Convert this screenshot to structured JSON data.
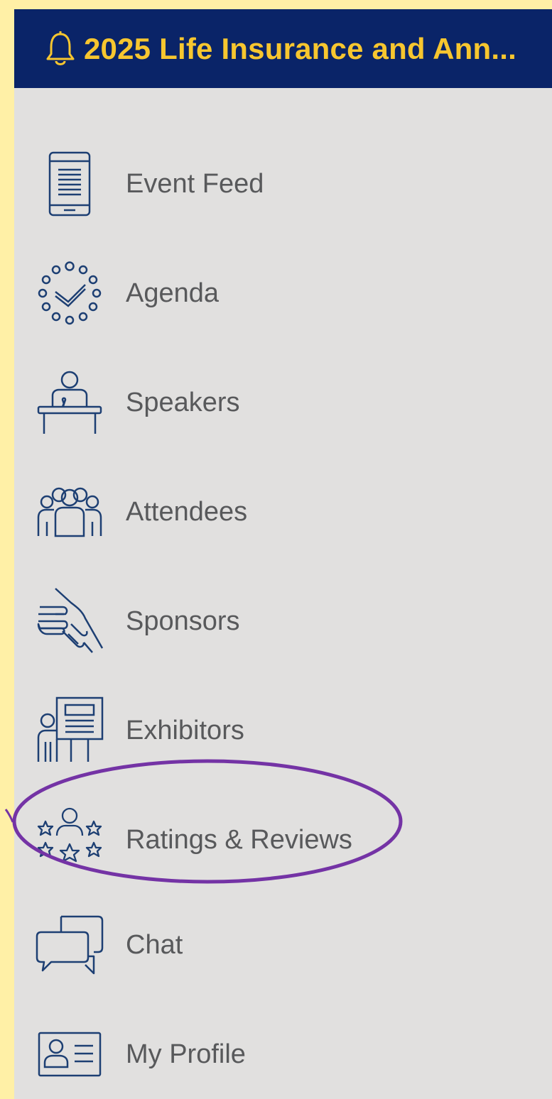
{
  "header": {
    "title": "2025 Life Insurance and Ann...",
    "bell_icon": "bell-icon",
    "background": "#0a2468",
    "title_color": "#f7c62f"
  },
  "menu": {
    "items": [
      {
        "label": "Event Feed",
        "icon": "tablet-icon"
      },
      {
        "label": "Agenda",
        "icon": "agenda-clock-icon"
      },
      {
        "label": "Speakers",
        "icon": "podium-speaker-icon"
      },
      {
        "label": "Attendees",
        "icon": "group-people-icon"
      },
      {
        "label": "Sponsors",
        "icon": "handshake-icon"
      },
      {
        "label": "Exhibitors",
        "icon": "presentation-board-icon"
      },
      {
        "label": "Ratings & Reviews",
        "icon": "person-stars-icon"
      },
      {
        "label": "Chat",
        "icon": "chat-bubbles-icon"
      },
      {
        "label": "My Profile",
        "icon": "profile-card-icon"
      }
    ],
    "text_color": "#58595b",
    "icon_color": "#1d3f73"
  },
  "annotation": {
    "highlighted_item": "Ratings & Reviews",
    "color": "#7433a5"
  }
}
